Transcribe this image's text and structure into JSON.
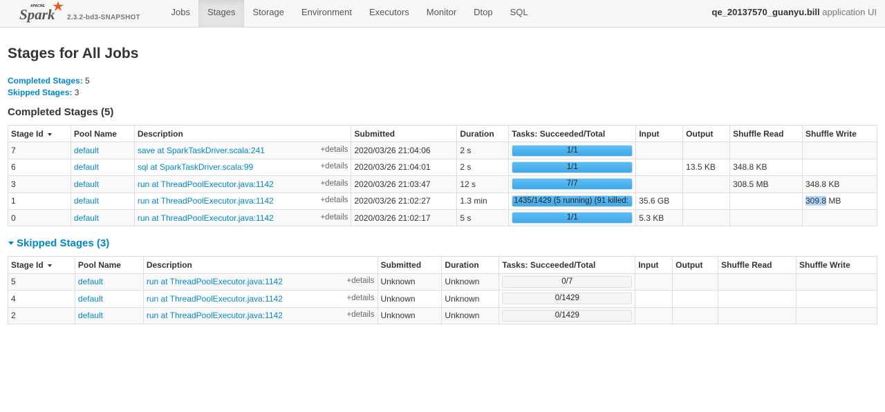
{
  "navbar": {
    "brand_small": "APACHE",
    "brand": "Spark",
    "version": "2.3.2-bd3-SNAPSHOT",
    "tabs": [
      {
        "label": "Jobs",
        "active": false
      },
      {
        "label": "Stages",
        "active": true
      },
      {
        "label": "Storage",
        "active": false
      },
      {
        "label": "Environment",
        "active": false
      },
      {
        "label": "Executors",
        "active": false
      },
      {
        "label": "Monitor",
        "active": false
      },
      {
        "label": "Dtop",
        "active": false
      },
      {
        "label": "SQL",
        "active": false
      }
    ],
    "app_name": "qe_20137570_guanyu.bill",
    "app_suffix": " application UI"
  },
  "page": {
    "title": "Stages for All Jobs",
    "summary": {
      "completed_label": "Completed Stages:",
      "completed_count": "5",
      "skipped_label": "Skipped Stages:",
      "skipped_count": "3"
    }
  },
  "completed": {
    "heading": "Completed Stages (5)",
    "columns": [
      "Stage Id",
      "Pool Name",
      "Description",
      "Submitted",
      "Duration",
      "Tasks: Succeeded/Total",
      "Input",
      "Output",
      "Shuffle Read",
      "Shuffle Write"
    ],
    "details_label": "+details",
    "rows": [
      {
        "id": "7",
        "pool": "default",
        "desc": "save at SparkTaskDriver.scala:241",
        "submitted": "2020/03/26 21:04:06",
        "duration": "2 s",
        "tasks": "1/1",
        "progress": 1.0,
        "input": "",
        "output": "",
        "shuffle_read": "",
        "shuffle_write": ""
      },
      {
        "id": "6",
        "pool": "default",
        "desc": "sql at SparkTaskDriver.scala:99",
        "submitted": "2020/03/26 21:04:01",
        "duration": "2 s",
        "tasks": "1/1",
        "progress": 1.0,
        "input": "",
        "output": "13.5 KB",
        "shuffle_read": "348.8 KB",
        "shuffle_write": ""
      },
      {
        "id": "3",
        "pool": "default",
        "desc": "run at ThreadPoolExecutor.java:1142",
        "submitted": "2020/03/26 21:03:47",
        "duration": "12 s",
        "tasks": "7/7",
        "progress": 1.0,
        "input": "",
        "output": "",
        "shuffle_read": "308.5 MB",
        "shuffle_write": "348.8 KB"
      },
      {
        "id": "1",
        "pool": "default",
        "desc": "run at ThreadPoolExecutor.java:1142",
        "submitted": "2020/03/26 21:02:27",
        "duration": "1.3 min",
        "tasks": "1435/1429 (5 running) (91 killed:",
        "progress": 1.0,
        "input": "35.6 GB",
        "output": "",
        "shuffle_read": "",
        "shuffle_write_hl": "309.8",
        "shuffle_write_rest": " MB"
      },
      {
        "id": "0",
        "pool": "default",
        "desc": "run at ThreadPoolExecutor.java:1142",
        "submitted": "2020/03/26 21:02:17",
        "duration": "5 s",
        "tasks": "1/1",
        "progress": 1.0,
        "input": "5.3 KB",
        "output": "",
        "shuffle_read": "",
        "shuffle_write": ""
      }
    ]
  },
  "skipped": {
    "heading": "Skipped Stages (3)",
    "columns": [
      "Stage Id",
      "Pool Name",
      "Description",
      "Submitted",
      "Duration",
      "Tasks: Succeeded/Total",
      "Input",
      "Output",
      "Shuffle Read",
      "Shuffle Write"
    ],
    "details_label": "+details",
    "rows": [
      {
        "id": "5",
        "pool": "default",
        "desc": "run at ThreadPoolExecutor.java:1142",
        "submitted": "Unknown",
        "duration": "Unknown",
        "tasks": "0/7",
        "progress": 0
      },
      {
        "id": "4",
        "pool": "default",
        "desc": "run at ThreadPoolExecutor.java:1142",
        "submitted": "Unknown",
        "duration": "Unknown",
        "tasks": "0/1429",
        "progress": 0
      },
      {
        "id": "2",
        "pool": "default",
        "desc": "run at ThreadPoolExecutor.java:1142",
        "submitted": "Unknown",
        "duration": "Unknown",
        "tasks": "0/1429",
        "progress": 0
      }
    ]
  },
  "colors": {
    "link": "#0088cc",
    "progress_bar": "#3fa8e8",
    "brand_orange": "#e25a1c"
  }
}
